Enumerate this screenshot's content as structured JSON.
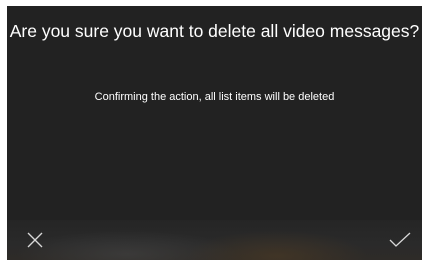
{
  "dialog": {
    "title": "Are you sure you want to delete all video messages?",
    "message": "Confirming the action, all list items will be deleted"
  },
  "actions": {
    "cancel_icon": "close-icon",
    "confirm_icon": "check-icon"
  },
  "colors": {
    "dialog_background": "#222222",
    "text": "#ffffff",
    "icon": "#d8d8d8"
  }
}
